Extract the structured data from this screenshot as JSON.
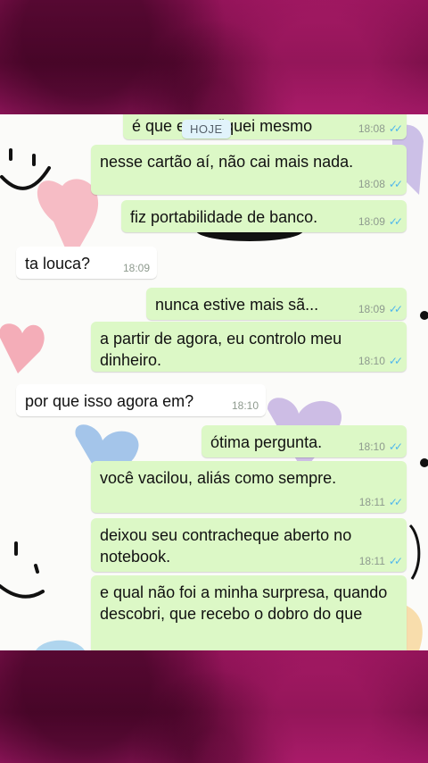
{
  "date_separator": "HOJE",
  "messages": [
    {
      "dir": "out",
      "text": "é que eu ... fiquei mesmo",
      "time": "18:08"
    },
    {
      "dir": "out",
      "text": "nesse cartão aí, não cai mais nada.",
      "time": "18:08"
    },
    {
      "dir": "out",
      "text": "fiz portabilidade de banco.",
      "time": "18:09"
    },
    {
      "dir": "in",
      "text": "ta louca?",
      "time": "18:09"
    },
    {
      "dir": "out",
      "text": "nunca estive mais sã...",
      "time": "18:09"
    },
    {
      "dir": "out",
      "text": "a partir de agora, eu controlo meu dinheiro.",
      "time": "18:10"
    },
    {
      "dir": "in",
      "text": "por que isso agora em?",
      "time": "18:10"
    },
    {
      "dir": "out",
      "text": "ótima pergunta.",
      "time": "18:10"
    },
    {
      "dir": "out",
      "text": "você vacilou, aliás como sempre.",
      "time": "18:11"
    },
    {
      "dir": "out",
      "text": "deixou seu contracheque aberto no notebook.",
      "time": "18:11"
    },
    {
      "dir": "out",
      "text": "e qual não foi a minha surpresa, quando descobri, que recebo o dobro do que",
      "time": ""
    }
  ],
  "read_receipt": "✓✓",
  "colors": {
    "outgoing": "#dcf8c6",
    "incoming": "#ffffff",
    "ticks": "#4fb6ec",
    "frame": "#7a0f48"
  },
  "icons": [
    "smiley-doodle",
    "heart-doodle",
    "double-check-icon"
  ]
}
